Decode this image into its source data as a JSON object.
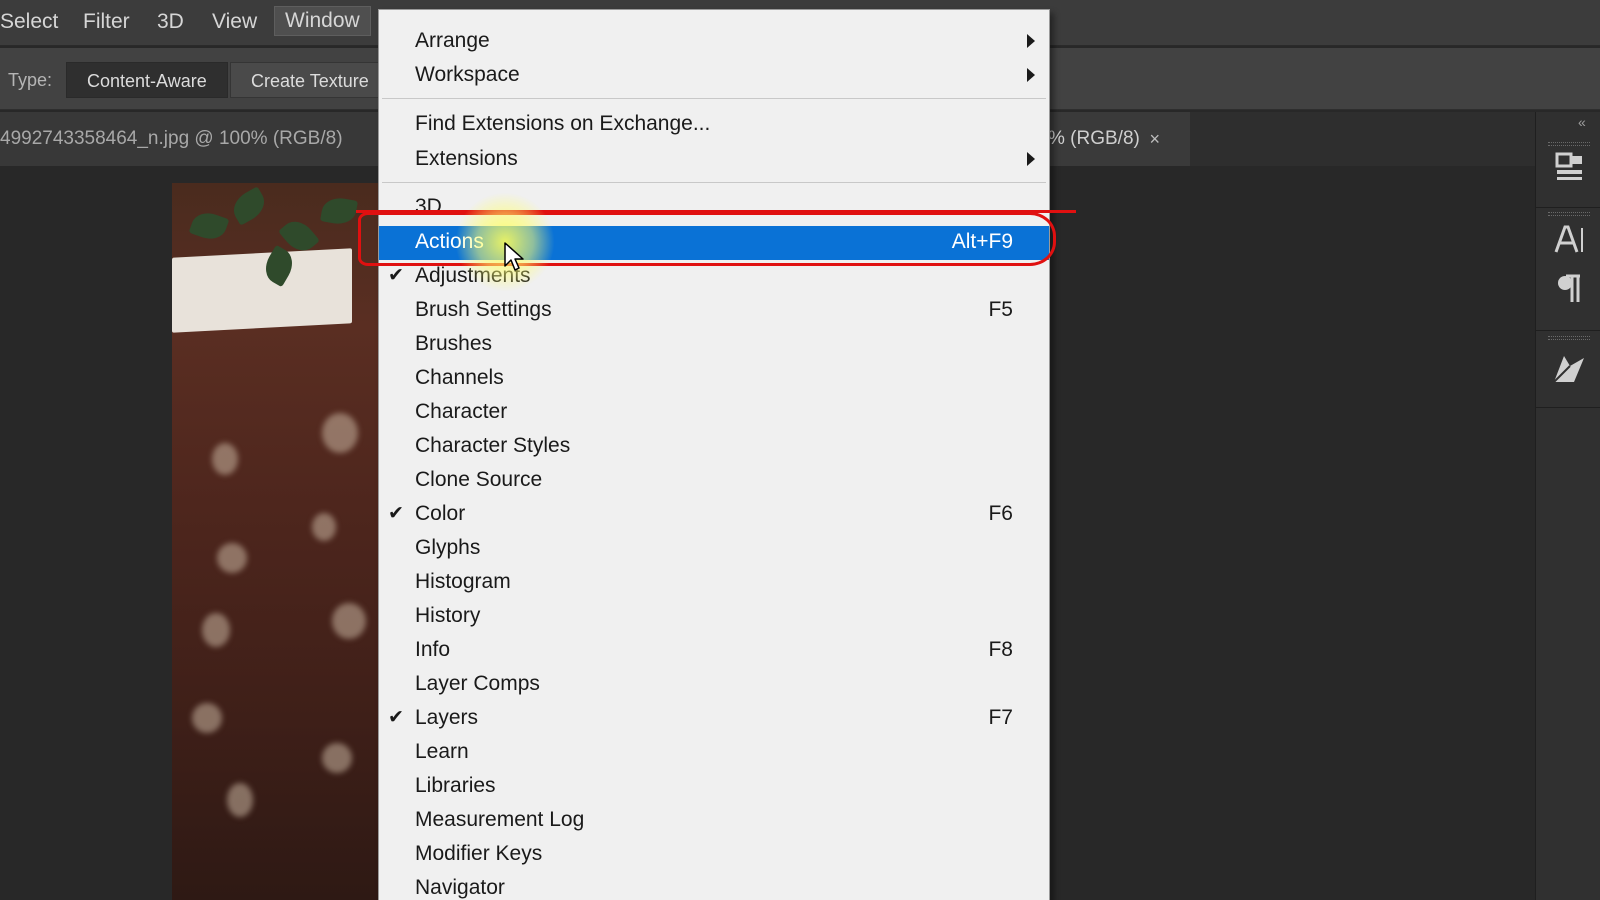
{
  "menubar": {
    "items": [
      "Select",
      "Filter",
      "3D",
      "View",
      "Window"
    ],
    "active": "Window"
  },
  "options_bar": {
    "type_label": "Type:",
    "buttons": [
      "Content-Aware",
      "Create Texture"
    ]
  },
  "tabs": {
    "doc1": "4992743358464_n.jpg @ 100% (RGB/8)",
    "doc2": "% (RGB/8)",
    "close_glyph": "×"
  },
  "right_panel": {
    "collapse_glyph": "«",
    "icons": [
      "3d-cube-icon",
      "character-icon",
      "paragraph-icon",
      "pen-tool-icon"
    ]
  },
  "window_menu": {
    "items": [
      {
        "label": "Arrange",
        "submenu": true
      },
      {
        "label": "Workspace",
        "submenu": true
      },
      {
        "label": "Find Extensions on Exchange...",
        "separator_before": true
      },
      {
        "label": "Extensions",
        "submenu": true
      },
      {
        "label": "3D",
        "separator_before": true
      },
      {
        "label": "Actions",
        "shortcut": "Alt+F9",
        "highlighted": true
      },
      {
        "label": "Adjustments",
        "checked": true
      },
      {
        "label": "Brush Settings",
        "shortcut": "F5"
      },
      {
        "label": "Brushes"
      },
      {
        "label": "Channels"
      },
      {
        "label": "Character"
      },
      {
        "label": "Character Styles"
      },
      {
        "label": "Clone Source"
      },
      {
        "label": "Color",
        "shortcut": "F6",
        "checked": true
      },
      {
        "label": "Glyphs"
      },
      {
        "label": "Histogram"
      },
      {
        "label": "History"
      },
      {
        "label": "Info",
        "shortcut": "F8"
      },
      {
        "label": "Layer Comps"
      },
      {
        "label": "Layers",
        "shortcut": "F7",
        "checked": true
      },
      {
        "label": "Learn"
      },
      {
        "label": "Libraries"
      },
      {
        "label": "Measurement Log"
      },
      {
        "label": "Modifier Keys"
      },
      {
        "label": "Navigator"
      }
    ]
  },
  "colors": {
    "highlight": "#0a72d6",
    "annotation": "#e01010",
    "menu_bg": "#f0f0f0"
  }
}
